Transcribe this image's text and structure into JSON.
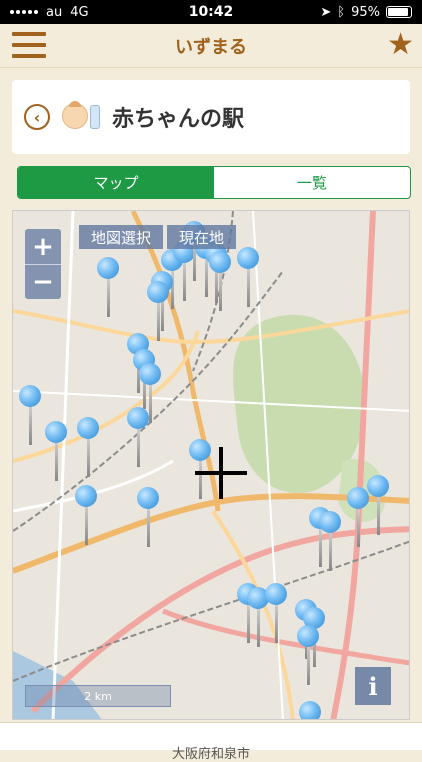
{
  "status": {
    "carrier": "au",
    "network": "4G",
    "time": "10:42",
    "battery": "95%"
  },
  "nav": {
    "title": "いずまる"
  },
  "header": {
    "title": "赤ちゃんの駅"
  },
  "tabs": [
    {
      "label": "マップ",
      "active": true
    },
    {
      "label": "一覧",
      "active": false
    }
  ],
  "map": {
    "zoom_in": "+",
    "zoom_out": "−",
    "select_label": "地図選択",
    "current_label": "現在地",
    "scale_label": "2 km",
    "info_label": "i",
    "pin_count": 31
  },
  "footer": {
    "text": "大阪府和泉市"
  },
  "colors": {
    "accent": "#a0621c",
    "green": "#1e9a44",
    "pin": "#6fbaf2"
  }
}
